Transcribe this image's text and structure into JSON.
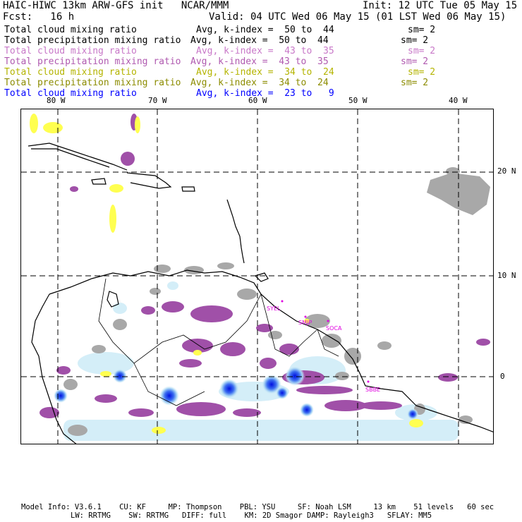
{
  "header": {
    "model_title": "HAIC-HIWC 13km ARW-GFS init   NCAR/MMM",
    "init": "Init: 12 UTC Tue 05 May 15",
    "forecast": "Fcst:   16 h",
    "valid": "Valid: 04 UTC Wed 06 May 15 (01 LST Wed 06 May 15)"
  },
  "legend": [
    {
      "field": "Total cloud mixing ratio",
      "range": "Avg, k-index =  50 to  44",
      "sm": "sm= 2",
      "color": "#000000"
    },
    {
      "field": "Total precipitation mixing ratio",
      "range": "Avg, k-index =  50 to  44",
      "sm": "sm= 2",
      "color": "#000000"
    },
    {
      "field": "Total cloud mixing ratio",
      "range": "Avg, k-index =  43 to  35",
      "sm": "sm= 2",
      "color": "#c878c8"
    },
    {
      "field": "Total precipitation mixing ratio",
      "range": "Avg, k-index =  43 to  35",
      "sm": "sm= 2",
      "color": "#b05ab0"
    },
    {
      "field": "Total cloud mixing ratio",
      "range": "Avg, k-index =  34 to  24",
      "sm": "sm= 2",
      "color": "#b4b400"
    },
    {
      "field": "Total precipitation mixing ratio",
      "range": "Avg, k-index =  34 to  24",
      "sm": "sm= 2",
      "color": "#8c8c00"
    },
    {
      "field": "Total cloud mixing ratio",
      "range": "Avg, k-index =  23 to   9",
      "sm": "",
      "color": "#0000ff"
    }
  ],
  "map": {
    "lon_labels": [
      "80 W",
      "70 W",
      "60 W",
      "50 W",
      "40 W"
    ],
    "lat_labels": [
      "20 N",
      "10 N",
      "0"
    ],
    "stations": [
      "SYEL",
      "SMJP",
      "SOCA",
      "SBBE"
    ],
    "colors": {
      "gray": "#a8a8a8",
      "purple": "#a050a8",
      "yellow": "#ffff50",
      "lightblue": "#cfeaf7",
      "blue": "#0818e8"
    }
  },
  "footer": {
    "line1": "Model Info: V3.6.1    CU: KF     MP: Thompson    PBL: YSU     SF: Noah LSM     13 km    51 levels   60 sec",
    "line2": "LW: RRTMG    SW: RRTMG   DIFF: full    KM: 2D Smagor DAMP: Rayleigh3   SFLAY: MM5"
  }
}
